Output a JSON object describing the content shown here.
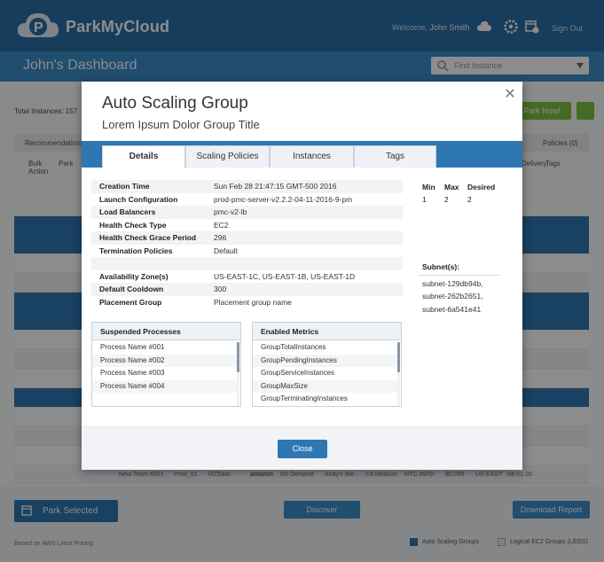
{
  "app": {
    "brand": "ParkMyCloud",
    "welcome_prefix": "Welcome,",
    "user_name": "John Smith",
    "sign_out": "Sign Out",
    "dashboard_title": "John's Dashboard",
    "find_placeholder": "Find Instance",
    "total_instances": "Total Instances: 157",
    "park_now": "Park Now!",
    "recommendations": "Recommendations",
    "policies": "Policies (0)",
    "col_bulk_action": "Bulk Action",
    "col_park": "Park",
    "col_delivery": "Delivery",
    "col_tags": "Tags",
    "bg_row": [
      "New Team #001",
      "Prod_01",
      "VIZSatic",
      "amazon",
      "On Demand",
      "Andy's We...",
      "C4.Medium",
      "NYC AWS!",
      "$0.099",
      "US-EAST",
      "04-01-20"
    ],
    "park_selected": "Park Selected",
    "discover": "Discover",
    "download_report": "Download Report",
    "footnote": "Based on AWS Linux Pricing",
    "legend_asg": "Auto Scaling Groups",
    "legend_logical": "Logical EC2 Groups (LEGS)",
    "colors": {
      "brand_blue": "#2b6fa8",
      "accent_blue": "#2e77b3",
      "green": "#7dc142"
    }
  },
  "modal": {
    "title": "Auto Scaling Group",
    "subtitle": "Lorem Ipsum Dolor Group Title",
    "close_label": "Close",
    "tabs": [
      {
        "label": "Details",
        "active": true
      },
      {
        "label": "Scaling Policies",
        "active": false
      },
      {
        "label": "Instances",
        "active": false
      },
      {
        "label": "Tags",
        "active": false
      }
    ],
    "details": [
      {
        "label": "Creation Time",
        "value": "Sun Feb 28 21:47:15  GMT-500 2016"
      },
      {
        "label": "Launch Configuration",
        "value": "prod-pmc-server-v2.2.2-04-11-2016-9-pm"
      },
      {
        "label": "Load Balancers",
        "value": "pmc-v2-lb"
      },
      {
        "label": "Health Check Type",
        "value": "EC2"
      },
      {
        "label": "Health Check Grace Period",
        "value": "296"
      },
      {
        "label": "Termination Policies",
        "value": "Default"
      },
      {
        "label": "",
        "value": ""
      },
      {
        "label": "Availability Zone(s)",
        "value": "US-EAST-1C, US-EAST-1B, US-EAST-1D"
      },
      {
        "label": "Default Cooldown",
        "value": "300"
      },
      {
        "label": "Placement Group",
        "value": "Placement group name"
      }
    ],
    "capacity": {
      "min_label": "Min",
      "min_value": "1",
      "max_label": "Max",
      "max_value": "2",
      "desired_label": "Desired",
      "desired_value": "2"
    },
    "subnets_label": "Subnet(s):",
    "subnets": [
      "subnet-129db94b,",
      "subnet-262b2651,",
      "subnet-6a541e41"
    ],
    "suspended": {
      "title": "Suspended Processes",
      "items": [
        "Process Name #001",
        "Process Name #002",
        "Process Name #003",
        "Process Name #004"
      ]
    },
    "metrics": {
      "title": "Enabled Metrics",
      "items": [
        "GroupTotalInstances",
        "GroupPendingInstances",
        "GroupServiceInstances",
        "GroupMaxSize",
        "GroupTerminatingInstances"
      ]
    }
  }
}
